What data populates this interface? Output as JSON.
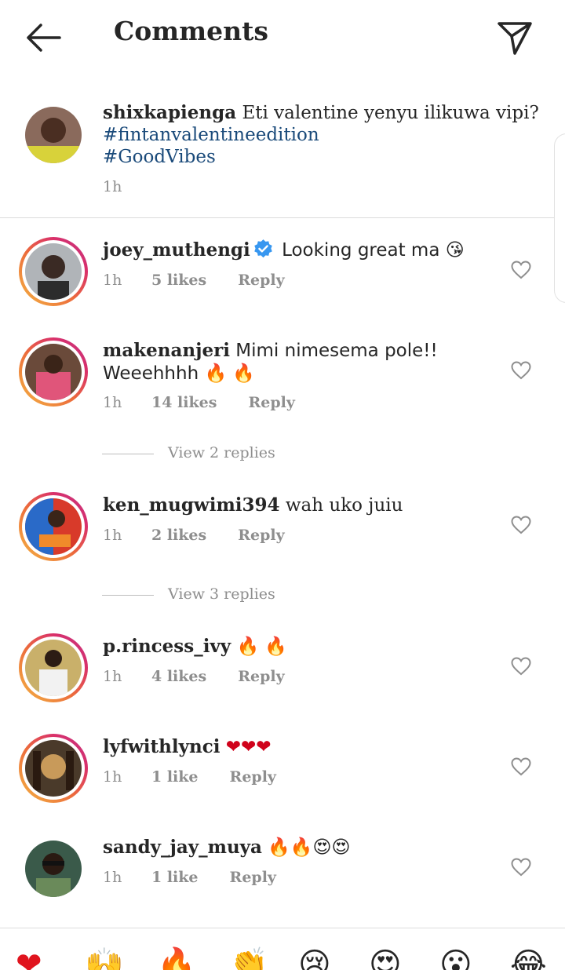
{
  "header": {
    "title": "Comments"
  },
  "caption": {
    "username": "shixkapienga",
    "text": "Eti valentine yenyu ilikuwa vipi?",
    "hashtags": [
      "#fintanvalentineedition",
      "#GoodVibes"
    ],
    "time": "1h"
  },
  "comments": [
    {
      "username": "joey_muthengi",
      "verified": true,
      "text": "Looking great ma 😘",
      "time": "1h",
      "likes": "5 likes",
      "reply": "Reply"
    },
    {
      "username": "makenanjeri",
      "text": "Mimi nimesema pole!! Weeehhhh 🔥 🔥",
      "time": "1h",
      "likes": "14 likes",
      "reply": "Reply",
      "view_replies": "View 2 replies"
    },
    {
      "username": "ken_mugwimi394",
      "text": "wah uko juiu",
      "time": "1h",
      "likes": "2 likes",
      "reply": "Reply",
      "view_replies": "View 3 replies"
    },
    {
      "username": "p.rincess_ivy",
      "text": "🔥 🔥",
      "time": "1h",
      "likes": "4 likes",
      "reply": "Reply"
    },
    {
      "username": "lyfwithlynci",
      "text": "❤❤❤",
      "time": "1h",
      "likes": "1 like",
      "reply": "Reply"
    },
    {
      "username": "sandy_jay_muya",
      "text": "🔥🔥😍😍",
      "time": "1h",
      "likes": "1 like",
      "reply": "Reply"
    }
  ],
  "emoji_bar": [
    "❤",
    "🙌",
    "🔥",
    "👏",
    "😢",
    "😍",
    "😮",
    "😂"
  ],
  "colors": {
    "hashtag": "#1a4a7a",
    "verified": "#3897f0",
    "muted": "#8e8e8e"
  }
}
